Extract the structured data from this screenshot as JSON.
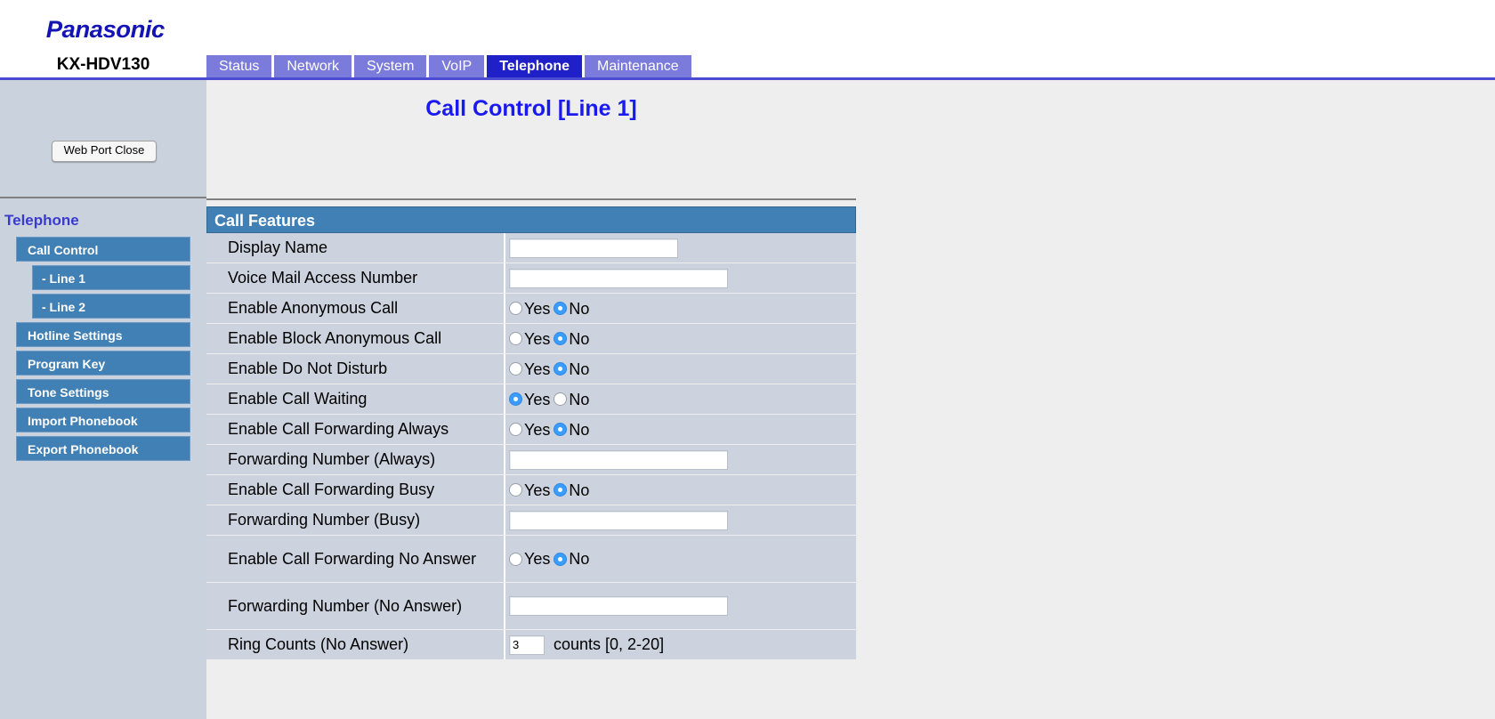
{
  "header": {
    "brand": "Panasonic",
    "model": "KX-HDV130"
  },
  "tabs": [
    {
      "label": "Status",
      "active": false
    },
    {
      "label": "Network",
      "active": false
    },
    {
      "label": "System",
      "active": false
    },
    {
      "label": "VoIP",
      "active": false
    },
    {
      "label": "Telephone",
      "active": true
    },
    {
      "label": "Maintenance",
      "active": false
    }
  ],
  "sidebar": {
    "web_port_close": "Web Port Close",
    "section_title": "Telephone",
    "items": [
      {
        "label": "Call Control",
        "level": 1
      },
      {
        "label": "- Line 1",
        "level": 2
      },
      {
        "label": "- Line 2",
        "level": 2
      },
      {
        "label": "Hotline Settings",
        "level": 1
      },
      {
        "label": "Program Key",
        "level": 1
      },
      {
        "label": "Tone Settings",
        "level": 1
      },
      {
        "label": "Import Phonebook",
        "level": 1
      },
      {
        "label": "Export Phonebook",
        "level": 1
      }
    ]
  },
  "main": {
    "page_title": "Call Control [Line 1]",
    "section_header": "Call Features",
    "radio_yes": "Yes",
    "radio_no": "No",
    "rows": [
      {
        "label": "Display Name",
        "type": "text",
        "value": "",
        "width": "w-190"
      },
      {
        "label": "Voice Mail Access Number",
        "type": "text",
        "value": "",
        "width": "w-246"
      },
      {
        "label": "Enable Anonymous Call",
        "type": "radio",
        "selected": "No"
      },
      {
        "label": "Enable Block Anonymous Call",
        "type": "radio",
        "selected": "No"
      },
      {
        "label": "Enable Do Not Disturb",
        "type": "radio",
        "selected": "No"
      },
      {
        "label": "Enable Call Waiting",
        "type": "radio",
        "selected": "Yes"
      },
      {
        "label": "Enable Call Forwarding Always",
        "type": "radio",
        "selected": "No"
      },
      {
        "label": "Forwarding Number (Always)",
        "type": "text",
        "value": "",
        "width": "w-246"
      },
      {
        "label": "Enable Call Forwarding Busy",
        "type": "radio",
        "selected": "No"
      },
      {
        "label": "Forwarding Number (Busy)",
        "type": "text",
        "value": "",
        "width": "w-246"
      },
      {
        "label": "Enable Call Forwarding No Answer",
        "type": "radio",
        "selected": "No",
        "tall": true
      },
      {
        "label": "Forwarding Number (No Answer)",
        "type": "text",
        "value": "",
        "width": "w-246",
        "tall": true
      },
      {
        "label": "Ring Counts (No Answer)",
        "type": "text",
        "value": "3",
        "width": "w-40",
        "hint": "counts [0, 2-20]"
      }
    ]
  },
  "colors": {
    "brand_blue": "#1414b4",
    "tab_inactive": "#7b7bdc",
    "tab_active": "#2020c8",
    "sidebar_bg": "#c9d2dd",
    "nav_item": "#4180b4",
    "section_header": "#4180b4",
    "row_bg": "#ccd3de",
    "title_blue": "#1a1aee",
    "radio_on": "#3b9cfd"
  }
}
